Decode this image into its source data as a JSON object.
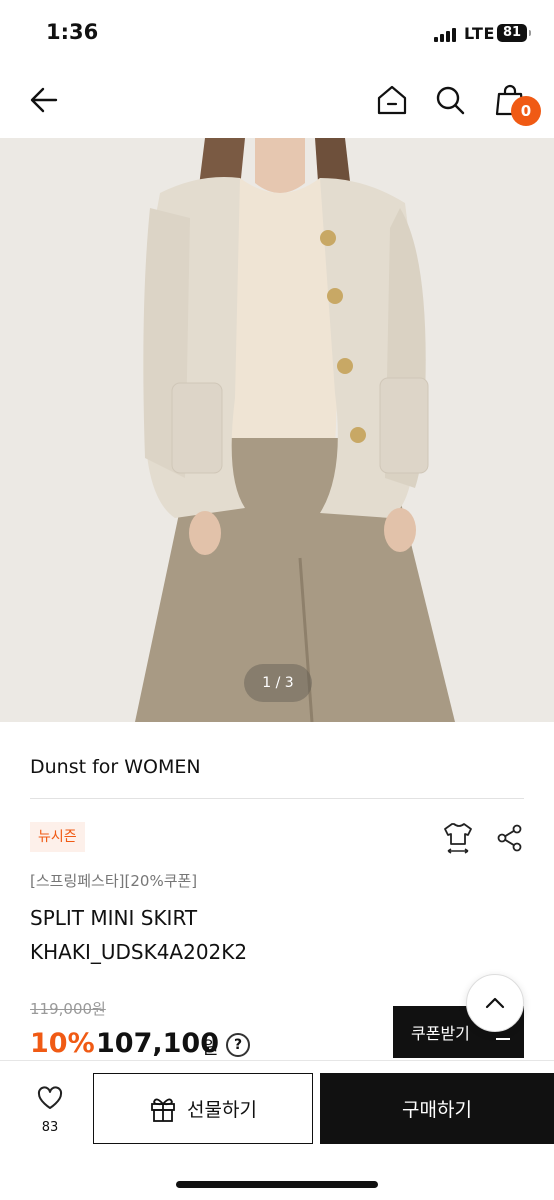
{
  "status": {
    "time": "1:36",
    "network": "LTE",
    "battery": "81"
  },
  "header": {
    "cart_count": "0"
  },
  "gallery": {
    "counter": "1 / 3"
  },
  "product": {
    "brand": "Dunst for WOMEN",
    "tag": "뉴시즌",
    "promo": "[스프링페스타][20%쿠폰]",
    "name_line1": "SPLIT MINI SKIRT",
    "name_line2": "KHAKI_UDSK4A202K2",
    "original_price": "119,000원",
    "discount": "10%",
    "price": "107,100",
    "currency": "원",
    "help": "?"
  },
  "coupon": {
    "label": "쿠폰받기"
  },
  "bottom": {
    "like_count": "83",
    "gift_label": "선물하기",
    "buy_label": "구매하기"
  },
  "colors": {
    "accent": "#f05a14",
    "dark": "#111111"
  },
  "icons": [
    "back-arrow-icon",
    "home-icon",
    "search-icon",
    "shopping-bag-icon",
    "size-guide-icon",
    "share-icon",
    "chevron-up-icon",
    "heart-icon",
    "gift-icon",
    "download-icon"
  ]
}
